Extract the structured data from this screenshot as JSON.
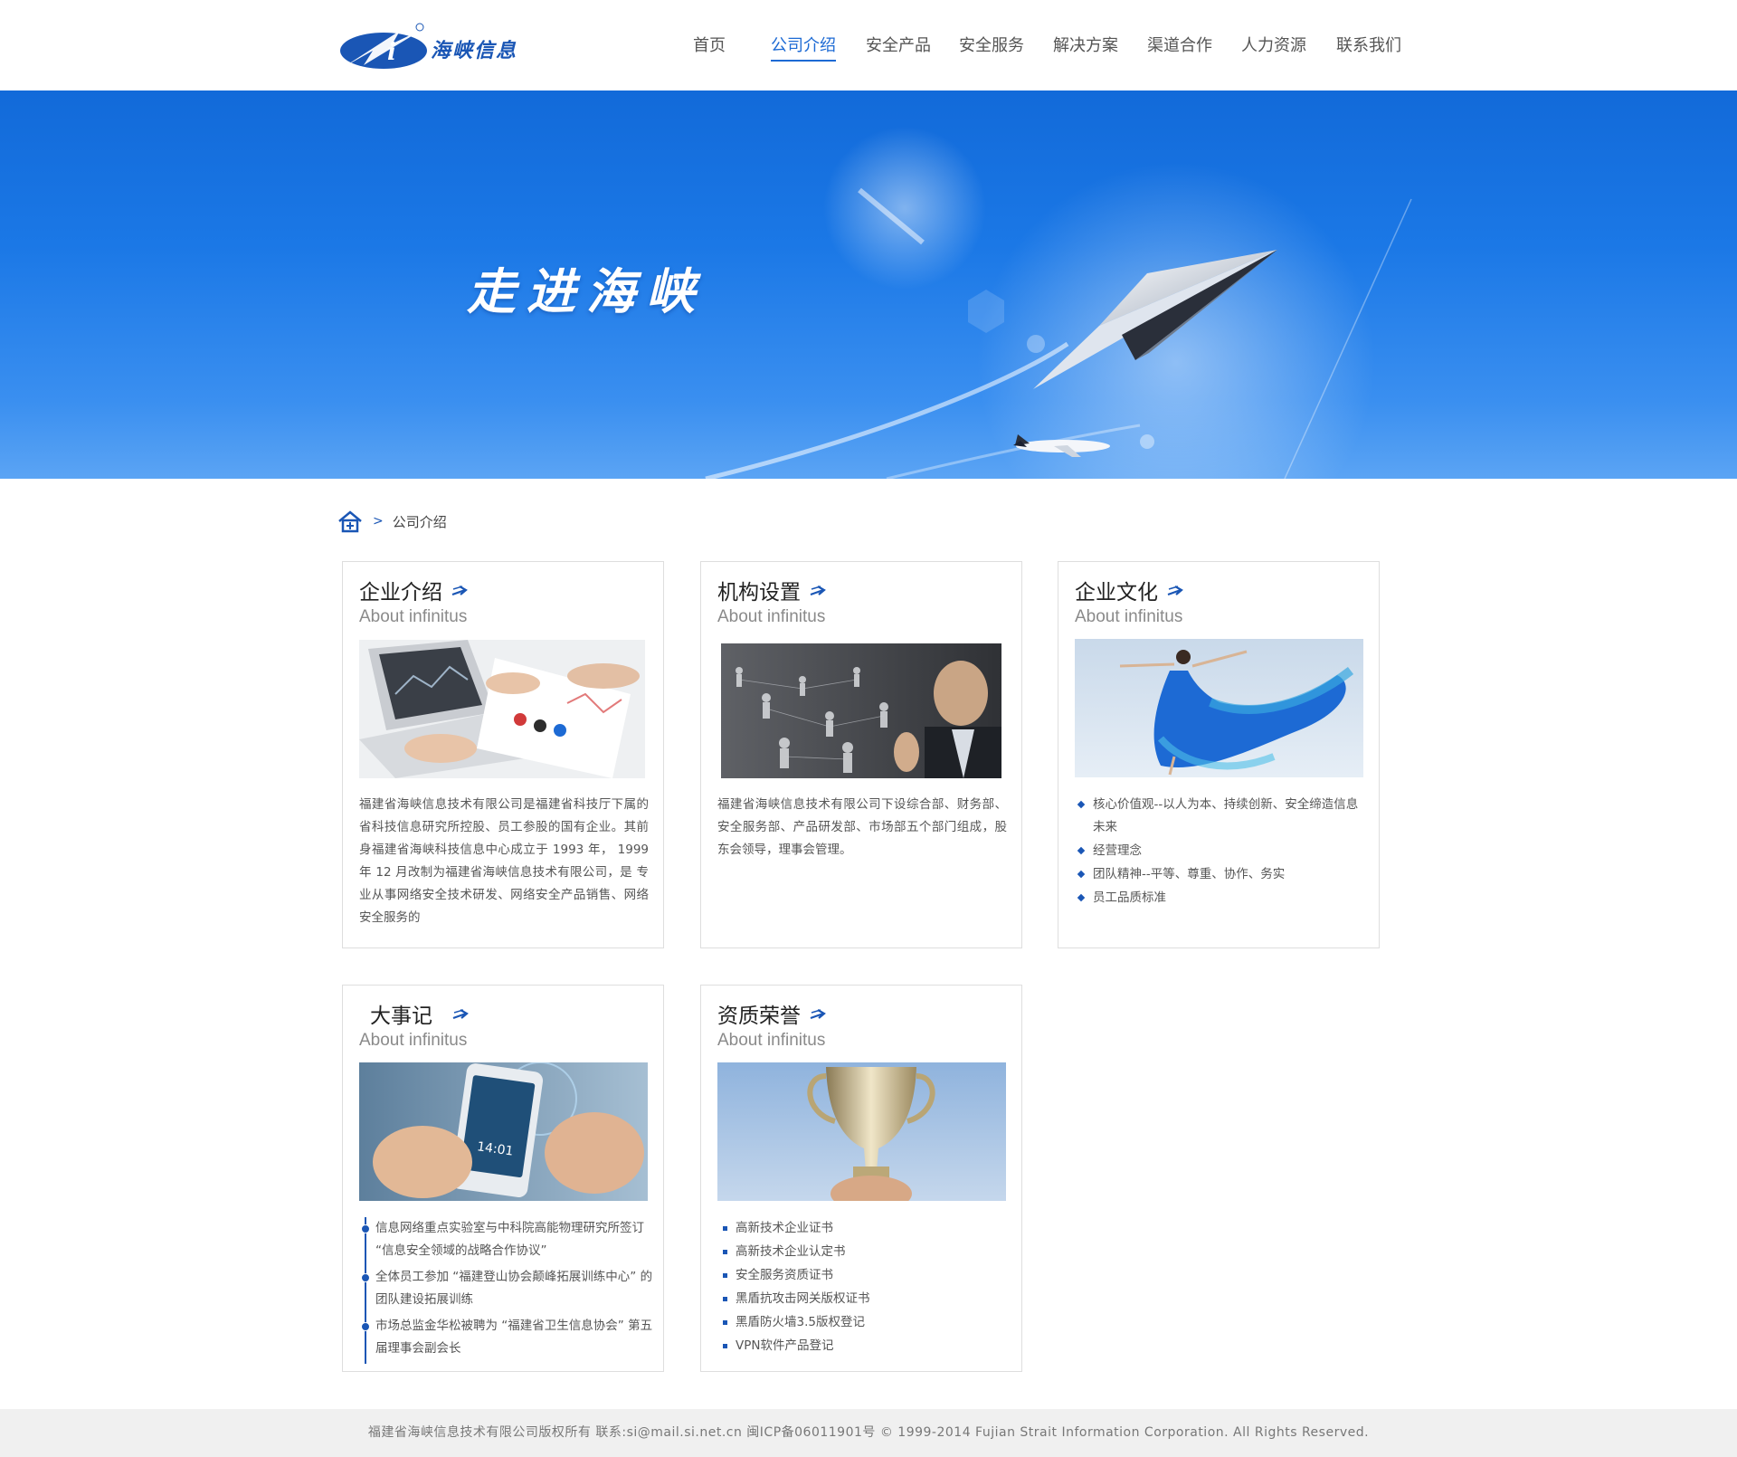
{
  "brand": {
    "name": "海峡信息",
    "registered_mark": "®",
    "color": "#1a56b5"
  },
  "nav": {
    "items": [
      {
        "label": "首页",
        "active": false
      },
      {
        "label": "公司介绍",
        "active": true
      },
      {
        "label": "安全产品",
        "active": false
      },
      {
        "label": "安全服务",
        "active": false
      },
      {
        "label": "解决方案",
        "active": false
      },
      {
        "label": "渠道合作",
        "active": false
      },
      {
        "label": "人力资源",
        "active": false
      },
      {
        "label": "联系我们",
        "active": false
      }
    ]
  },
  "banner": {
    "title": "走进海峡"
  },
  "breadcrumb": {
    "separator": ">",
    "current": "公司介绍"
  },
  "cards": [
    {
      "title": "企业介绍",
      "subtitle": "About infinitus",
      "image": "laptop-charts-photo",
      "text": "福建省海峡信息技术有限公司是福建省科技厅下属的省科技信息研究所控股、员工参股的国有企业。其前身福建省海峡科技信息中心成立于 1993 年， 1999 年 12 月改制为福建省海峡信息技术有限公司，是 专业从事网络安全技术研发、网络安全产品销售、网络安全服务的"
    },
    {
      "title": "机构设置",
      "subtitle": "About infinitus",
      "image": "business-network-photo",
      "text": "福建省海峡信息技术有限公司下设综合部、财务部、安全服务部、产品研发部、市场部五个部门组成，股东会领导，理事会管理。"
    },
    {
      "title": "企业文化",
      "subtitle": "About infinitus",
      "image": "dancer-blue-dress-photo",
      "items": [
        "核心价值观--以人为本、持续创新、安全缔造信息未来",
        "经营理念",
        "团队精神--平等、尊重、协作、务实",
        "员工品质标准"
      ]
    },
    {
      "title": "大事记",
      "subtitle": "About infinitus",
      "image": "smartphone-hands-photo",
      "items": [
        "信息网络重点实验室与中科院高能物理研究所签订 “信息安全领域的战略合作协议”",
        "全体员工参加 “福建登山协会颠峰拓展训练中心” 的团队建设拓展训练",
        "市场总监金华松被聘为 “福建省卫生信息协会” 第五届理事会副会长"
      ],
      "phone_time": "14:01"
    },
    {
      "title": "资质荣誉",
      "subtitle": "About infinitus",
      "image": "trophy-photo",
      "items": [
        "高新技术企业证书",
        "高新技术企业认定书",
        "安全服务资质证书",
        "黑盾抗攻击网关版权证书",
        "黑盾防火墙3.5版权登记",
        "VPN软件产品登记"
      ]
    }
  ],
  "footer": {
    "text": "福建省海峡信息技术有限公司版权所有 联系:si@mail.si.net.cn 闽ICP备06011901号 © 1999-2014 Fujian Strait Information Corporation. All Rights Reserved."
  }
}
